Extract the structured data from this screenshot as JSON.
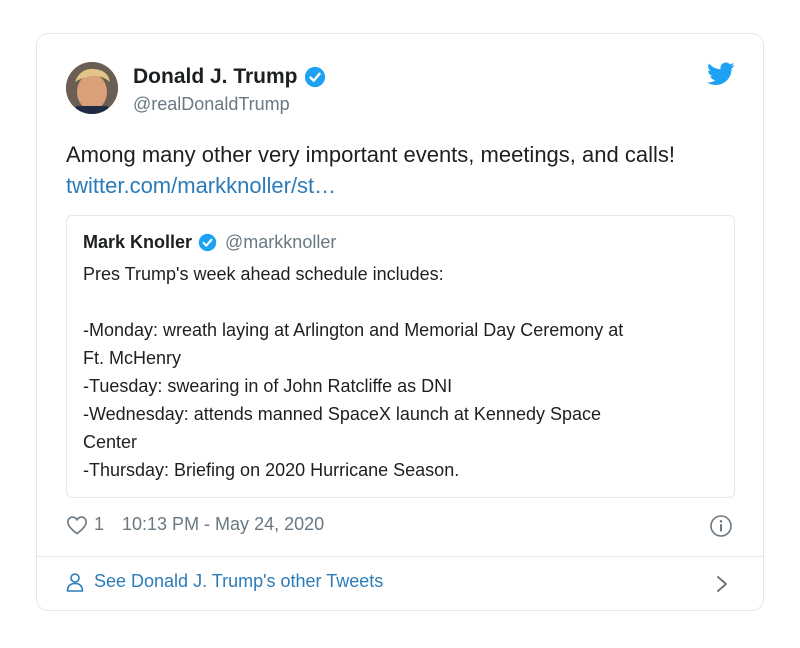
{
  "tweet": {
    "author": {
      "name": "Donald J. Trump",
      "handle": "@realDonaldTrump"
    },
    "text_line1": "Among many other very important events, meetings, and calls!",
    "link_text": "twitter.com/markknoller/st…",
    "quoted": {
      "name": "Mark Knoller",
      "handle": "@markknoller",
      "lines": [
        "Pres Trump's week ahead schedule includes:",
        "",
        "-Monday: wreath laying at Arlington and Memorial Day Ceremony at",
        "Ft. McHenry",
        "-Tuesday: swearing in of John Ratcliffe as DNI",
        "-Wednesday: attends manned SpaceX launch at Kennedy Space",
        "Center",
        "-Thursday: Briefing on 2020 Hurricane Season."
      ]
    },
    "like_count": "1",
    "timestamp": "10:13 PM - May 24, 2020",
    "footer_link": "See Donald J. Trump's other Tweets"
  },
  "colors": {
    "link": "#2b7bb9",
    "verified": "#1da1f2",
    "secondary_text": "#697882",
    "border": "#e1e8ed"
  },
  "icons": [
    "verified-badge-icon",
    "twitter-bird-icon",
    "heart-icon",
    "info-icon",
    "person-icon",
    "chevron-right-icon"
  ]
}
